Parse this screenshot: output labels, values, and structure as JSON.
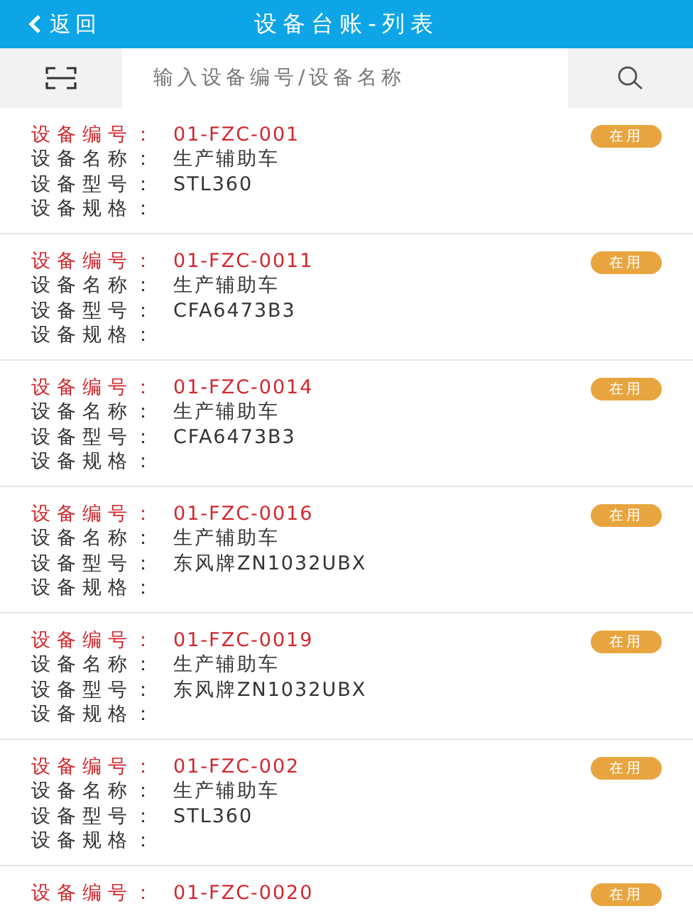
{
  "header": {
    "back": "返回",
    "title": "设备台账-列表"
  },
  "search": {
    "placeholder": "输入设备编号/设备名称"
  },
  "items": [
    {
      "status": "在用",
      "fields": [
        {
          "kind": "code",
          "label": "设备编号：",
          "value": "01-FZC-001"
        },
        {
          "kind": "plain",
          "label": "设备名称：",
          "value": "生产辅助车"
        },
        {
          "kind": "plain",
          "label": "设备型号：",
          "value": "STL360"
        },
        {
          "kind": "plain",
          "label": "设备规格："
        }
      ]
    },
    {
      "status": "在用",
      "fields": [
        {
          "kind": "code",
          "label": "设备编号：",
          "value": "01-FZC-0011"
        },
        {
          "kind": "plain",
          "label": "设备名称：",
          "value": "生产辅助车"
        },
        {
          "kind": "plain",
          "label": "设备型号：",
          "value": "CFA6473B3"
        },
        {
          "kind": "plain",
          "label": "设备规格："
        }
      ]
    },
    {
      "status": "在用",
      "fields": [
        {
          "kind": "code",
          "label": "设备编号：",
          "value": "01-FZC-0014"
        },
        {
          "kind": "plain",
          "label": "设备名称：",
          "value": "生产辅助车"
        },
        {
          "kind": "plain",
          "label": "设备型号：",
          "value": "CFA6473B3"
        },
        {
          "kind": "plain",
          "label": "设备规格："
        }
      ]
    },
    {
      "status": "在用",
      "fields": [
        {
          "kind": "code",
          "label": "设备编号：",
          "value": "01-FZC-0016"
        },
        {
          "kind": "plain",
          "label": "设备名称：",
          "value": "生产辅助车"
        },
        {
          "kind": "plain",
          "label": "设备型号：",
          "value": "东风牌ZN1032UBX"
        },
        {
          "kind": "plain",
          "label": "设备规格："
        }
      ]
    },
    {
      "status": "在用",
      "fields": [
        {
          "kind": "code",
          "label": "设备编号：",
          "value": "01-FZC-0019"
        },
        {
          "kind": "plain",
          "label": "设备名称：",
          "value": "生产辅助车"
        },
        {
          "kind": "plain",
          "label": "设备型号：",
          "value": "东风牌ZN1032UBX"
        },
        {
          "kind": "plain",
          "label": "设备规格："
        }
      ]
    },
    {
      "status": "在用",
      "fields": [
        {
          "kind": "code",
          "label": "设备编号：",
          "value": "01-FZC-002"
        },
        {
          "kind": "plain",
          "label": "设备名称：",
          "value": "生产辅助车"
        },
        {
          "kind": "plain",
          "label": "设备型号：",
          "value": "STL360"
        },
        {
          "kind": "plain",
          "label": "设备规格："
        }
      ]
    },
    {
      "status": "在用",
      "fields": [
        {
          "kind": "code",
          "label": "设备编号：",
          "value": "01-FZC-0020"
        }
      ]
    }
  ]
}
